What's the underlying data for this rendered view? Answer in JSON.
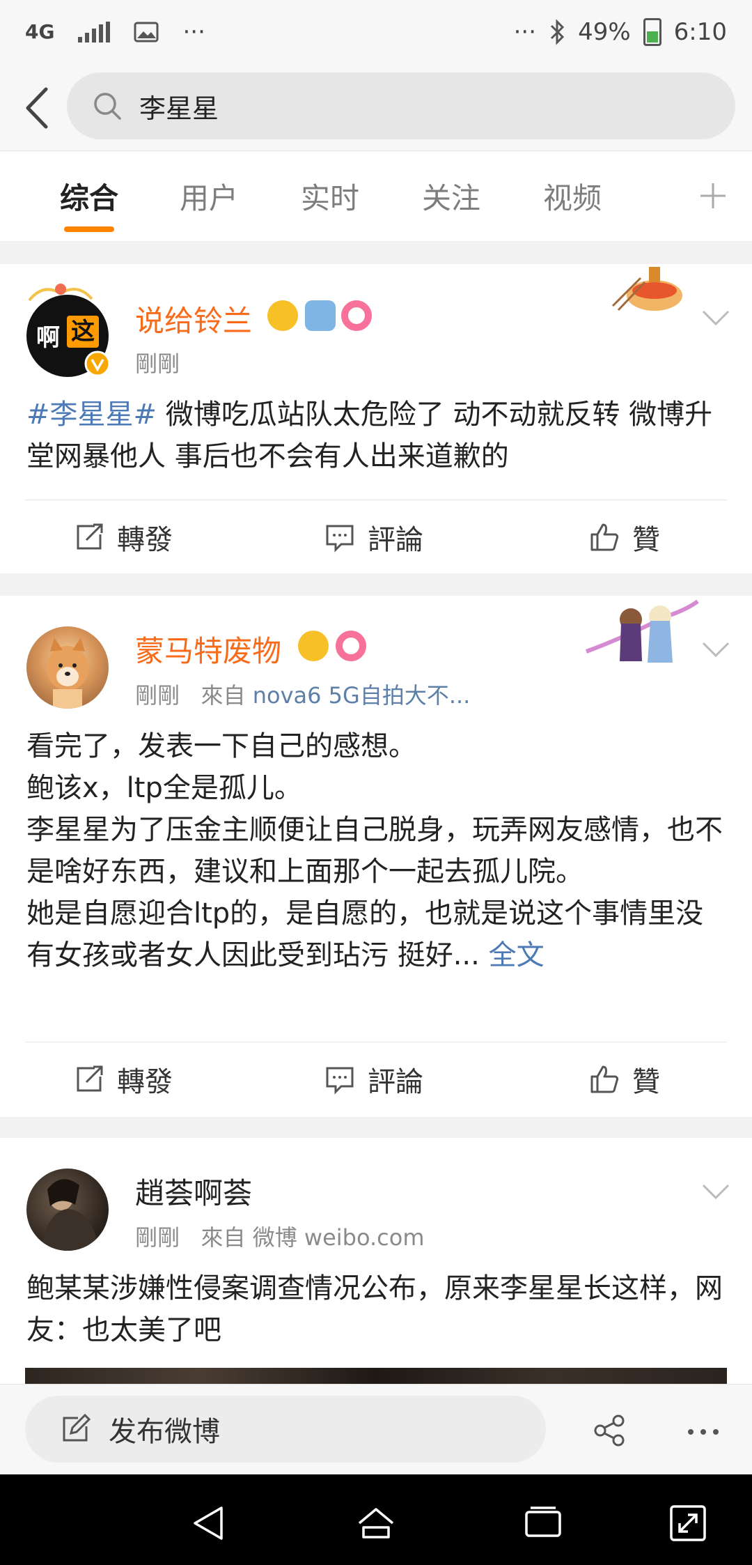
{
  "status_bar": {
    "network": "4G",
    "dots_left": "···",
    "dots_right": "···",
    "battery": "49%",
    "time": "6:10"
  },
  "search": {
    "query": "李星星"
  },
  "tabs": [
    {
      "label": "综合",
      "active": true
    },
    {
      "label": "用户",
      "active": false
    },
    {
      "label": "实时",
      "active": false
    },
    {
      "label": "关注",
      "active": false
    },
    {
      "label": "视频",
      "active": false
    }
  ],
  "tab_add_icon": "plus-icon",
  "posts": [
    {
      "username": "说给铃兰",
      "time": "剛剛",
      "source_prefix": "",
      "source": "",
      "hashtag": "#李星星#",
      "text": " 微博吃瓜站队太危险了 动不动就反转 微博升堂网暴他人 事后也不会有人出来道歉的",
      "avatar_text_1": "啊",
      "avatar_text_2": "这"
    },
    {
      "username": "蒙马特废物",
      "time": "剛剛",
      "source_prefix": "來自",
      "source": "nova6 5G自拍大不...",
      "lines": [
        "看完了，发表一下自己的感想。",
        "鲍该x，ltp全是孤儿。",
        "李星星为了压金主顺便让自己脱身，玩弄网友感情，也不是啥好东西，建议和上面那个一起去孤儿院。",
        "她是自愿迎合ltp的，是自愿的，也就是说这个事情里没有女孩或者女人因此受到玷污 挺好..."
      ],
      "more": "全文"
    },
    {
      "username": "趙荟啊荟",
      "time": "剛剛",
      "source_prefix": "來自",
      "source": "微博 weibo.com",
      "text": "鲍某某涉嫌性侵案调查情况公布，原来李星星长这样，网友：也太美了吧"
    }
  ],
  "actions": {
    "repost": "轉發",
    "comment": "評論",
    "like": "贊"
  },
  "compose": {
    "label": "发布微博"
  },
  "colors": {
    "accent": "#ff8200",
    "vip_name": "#f86b1b",
    "link": "#4d79b5"
  }
}
